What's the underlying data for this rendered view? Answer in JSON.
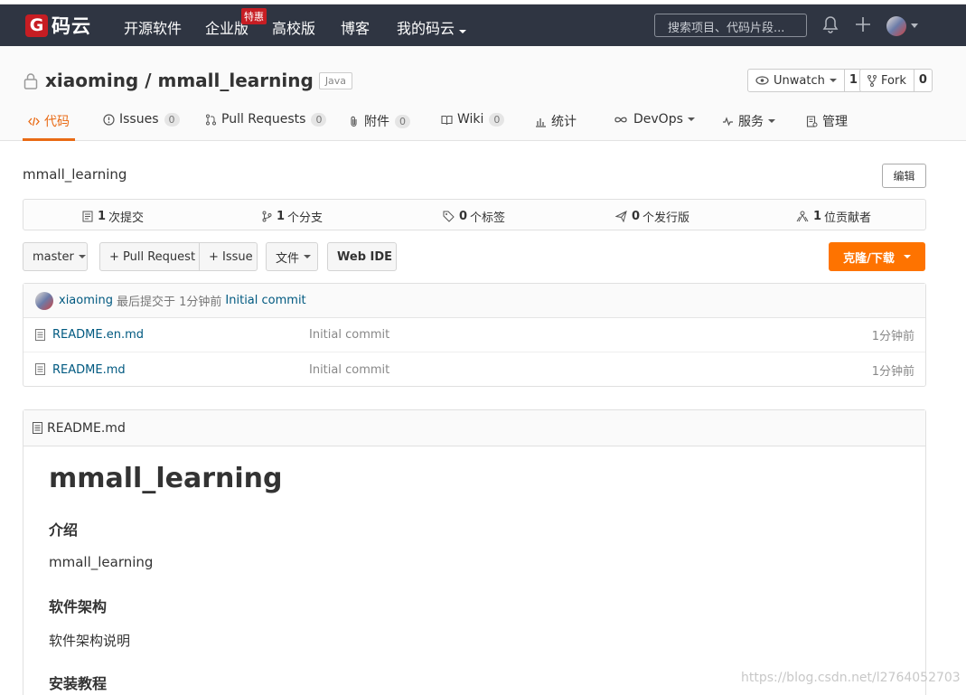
{
  "nav": {
    "logo_mark": "G",
    "logo_text": "码云",
    "items": [
      "开源软件",
      "企业版",
      "高校版",
      "博客",
      "我的码云"
    ],
    "badge": "特惠",
    "search_placeholder": "搜索项目、代码片段..."
  },
  "repo": {
    "owner": "xiaoming",
    "separator": " / ",
    "name": "mmall_learning",
    "language": "Java",
    "watch_label": "Unwatch",
    "watch_count": "1",
    "fork_label": "Fork",
    "fork_count": "0"
  },
  "tabs": [
    {
      "label": "代码",
      "count": null
    },
    {
      "label": "Issues",
      "count": "0"
    },
    {
      "label": "Pull Requests",
      "count": "0"
    },
    {
      "label": "附件",
      "count": "0"
    },
    {
      "label": "Wiki",
      "count": "0"
    },
    {
      "label": "统计",
      "count": null
    },
    {
      "label": "DevOps",
      "count": null
    },
    {
      "label": "服务",
      "count": null
    },
    {
      "label": "管理",
      "count": null
    }
  ],
  "description": "mmall_learning",
  "edit_label": "编辑",
  "stats": [
    {
      "num": "1",
      "label": "次提交"
    },
    {
      "num": "1",
      "label": "个分支"
    },
    {
      "num": "0",
      "label": "个标签"
    },
    {
      "num": "0",
      "label": "个发行版"
    },
    {
      "num": "1",
      "label": "位贡献者"
    }
  ],
  "toolbar": {
    "branch": "master",
    "pull_request": "+ Pull Request",
    "issue": "+ Issue",
    "files": "文件",
    "web_ide": "Web IDE",
    "clone": "克隆/下载"
  },
  "commit": {
    "author": "xiaoming",
    "meta": "最后提交于 1分钟前",
    "message": "Initial commit"
  },
  "files": [
    {
      "name": "README.en.md",
      "message": "Initial commit",
      "time": "1分钟前"
    },
    {
      "name": "README.md",
      "message": "Initial commit",
      "time": "1分钟前"
    }
  ],
  "readme": {
    "file": "README.md",
    "h1": "mmall_learning",
    "sections": [
      {
        "heading": "介绍",
        "text": "mmall_learning"
      },
      {
        "heading": "软件架构",
        "text": "软件架构说明"
      },
      {
        "heading": "安装教程",
        "text": ""
      }
    ]
  },
  "watermark": "https://blog.csdn.net/l2764052703",
  "colors": {
    "nav_bg": "#2f3542",
    "accent": "#e96a14",
    "clone_bg": "#fe7300",
    "brand_red": "#c71d23",
    "link": "#005980"
  }
}
